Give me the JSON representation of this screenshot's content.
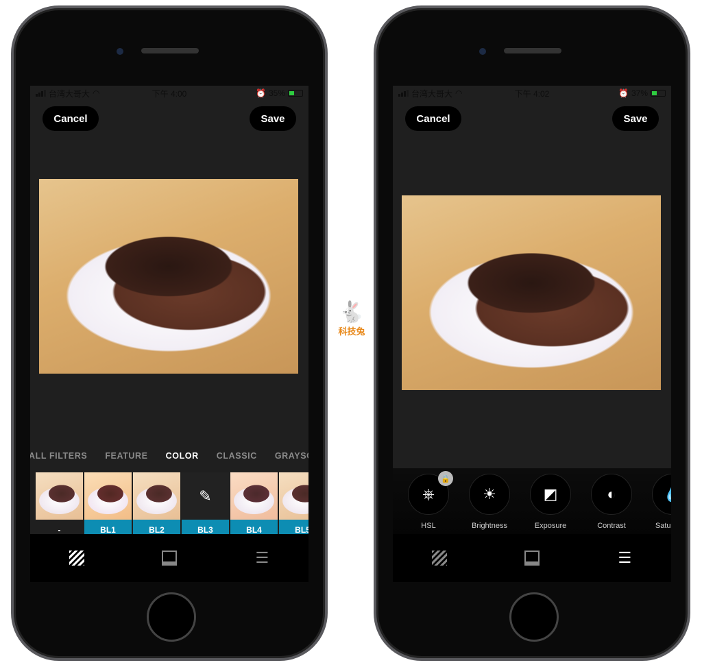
{
  "left": {
    "status": {
      "carrier": "台湾大哥大",
      "time": "下午 4:00",
      "battery": "35%"
    },
    "cancel": "Cancel",
    "save": "Save",
    "tabs": [
      "ALL FILTERS",
      "FEATURE",
      "COLOR",
      "CLASSIC",
      "GRAYSCALE"
    ],
    "active_tab": "COLOR",
    "filters": [
      "-",
      "BL1",
      "BL2",
      "BL3",
      "BL4",
      "BL5"
    ],
    "filter_accent": "#0d8db3",
    "toolbar": [
      "filters-icon",
      "frame-icon",
      "adjust-icon"
    ]
  },
  "right": {
    "status": {
      "carrier": "台湾大哥大",
      "time": "下午 4:02",
      "battery": "37%"
    },
    "cancel": "Cancel",
    "save": "Save",
    "adjustments": [
      {
        "label": "HSL",
        "icon": "hsl-wheel-icon",
        "locked": true
      },
      {
        "label": "Brightness",
        "icon": "sun-icon"
      },
      {
        "label": "Exposure",
        "icon": "exposure-icon"
      },
      {
        "label": "Contrast",
        "icon": "contrast-icon"
      },
      {
        "label": "Saturation",
        "icon": "saturation-icon"
      }
    ],
    "toolbar": [
      "filters-icon",
      "frame-icon",
      "adjust-icon"
    ]
  },
  "watermark": {
    "text": "科技兔",
    "color": "#e8891b"
  }
}
